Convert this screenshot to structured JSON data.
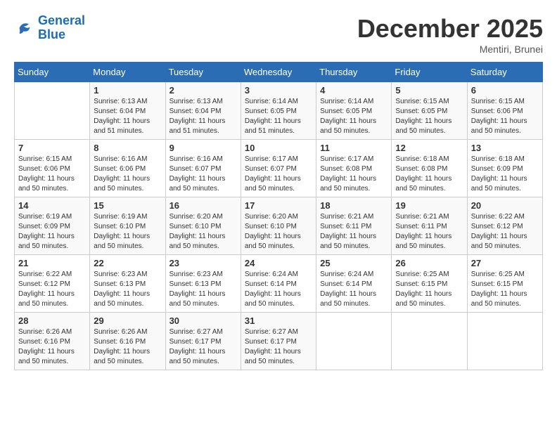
{
  "logo": {
    "line1": "General",
    "line2": "Blue"
  },
  "title": "December 2025",
  "subtitle": "Mentiri, Brunei",
  "header_days": [
    "Sunday",
    "Monday",
    "Tuesday",
    "Wednesday",
    "Thursday",
    "Friday",
    "Saturday"
  ],
  "weeks": [
    [
      {
        "day": "",
        "info": ""
      },
      {
        "day": "1",
        "info": "Sunrise: 6:13 AM\nSunset: 6:04 PM\nDaylight: 11 hours\nand 51 minutes."
      },
      {
        "day": "2",
        "info": "Sunrise: 6:13 AM\nSunset: 6:04 PM\nDaylight: 11 hours\nand 51 minutes."
      },
      {
        "day": "3",
        "info": "Sunrise: 6:14 AM\nSunset: 6:05 PM\nDaylight: 11 hours\nand 51 minutes."
      },
      {
        "day": "4",
        "info": "Sunrise: 6:14 AM\nSunset: 6:05 PM\nDaylight: 11 hours\nand 50 minutes."
      },
      {
        "day": "5",
        "info": "Sunrise: 6:15 AM\nSunset: 6:05 PM\nDaylight: 11 hours\nand 50 minutes."
      },
      {
        "day": "6",
        "info": "Sunrise: 6:15 AM\nSunset: 6:06 PM\nDaylight: 11 hours\nand 50 minutes."
      }
    ],
    [
      {
        "day": "7",
        "info": "Sunrise: 6:15 AM\nSunset: 6:06 PM\nDaylight: 11 hours\nand 50 minutes."
      },
      {
        "day": "8",
        "info": "Sunrise: 6:16 AM\nSunset: 6:06 PM\nDaylight: 11 hours\nand 50 minutes."
      },
      {
        "day": "9",
        "info": "Sunrise: 6:16 AM\nSunset: 6:07 PM\nDaylight: 11 hours\nand 50 minutes."
      },
      {
        "day": "10",
        "info": "Sunrise: 6:17 AM\nSunset: 6:07 PM\nDaylight: 11 hours\nand 50 minutes."
      },
      {
        "day": "11",
        "info": "Sunrise: 6:17 AM\nSunset: 6:08 PM\nDaylight: 11 hours\nand 50 minutes."
      },
      {
        "day": "12",
        "info": "Sunrise: 6:18 AM\nSunset: 6:08 PM\nDaylight: 11 hours\nand 50 minutes."
      },
      {
        "day": "13",
        "info": "Sunrise: 6:18 AM\nSunset: 6:09 PM\nDaylight: 11 hours\nand 50 minutes."
      }
    ],
    [
      {
        "day": "14",
        "info": "Sunrise: 6:19 AM\nSunset: 6:09 PM\nDaylight: 11 hours\nand 50 minutes."
      },
      {
        "day": "15",
        "info": "Sunrise: 6:19 AM\nSunset: 6:10 PM\nDaylight: 11 hours\nand 50 minutes."
      },
      {
        "day": "16",
        "info": "Sunrise: 6:20 AM\nSunset: 6:10 PM\nDaylight: 11 hours\nand 50 minutes."
      },
      {
        "day": "17",
        "info": "Sunrise: 6:20 AM\nSunset: 6:10 PM\nDaylight: 11 hours\nand 50 minutes."
      },
      {
        "day": "18",
        "info": "Sunrise: 6:21 AM\nSunset: 6:11 PM\nDaylight: 11 hours\nand 50 minutes."
      },
      {
        "day": "19",
        "info": "Sunrise: 6:21 AM\nSunset: 6:11 PM\nDaylight: 11 hours\nand 50 minutes."
      },
      {
        "day": "20",
        "info": "Sunrise: 6:22 AM\nSunset: 6:12 PM\nDaylight: 11 hours\nand 50 minutes."
      }
    ],
    [
      {
        "day": "21",
        "info": "Sunrise: 6:22 AM\nSunset: 6:12 PM\nDaylight: 11 hours\nand 50 minutes."
      },
      {
        "day": "22",
        "info": "Sunrise: 6:23 AM\nSunset: 6:13 PM\nDaylight: 11 hours\nand 50 minutes."
      },
      {
        "day": "23",
        "info": "Sunrise: 6:23 AM\nSunset: 6:13 PM\nDaylight: 11 hours\nand 50 minutes."
      },
      {
        "day": "24",
        "info": "Sunrise: 6:24 AM\nSunset: 6:14 PM\nDaylight: 11 hours\nand 50 minutes."
      },
      {
        "day": "25",
        "info": "Sunrise: 6:24 AM\nSunset: 6:14 PM\nDaylight: 11 hours\nand 50 minutes."
      },
      {
        "day": "26",
        "info": "Sunrise: 6:25 AM\nSunset: 6:15 PM\nDaylight: 11 hours\nand 50 minutes."
      },
      {
        "day": "27",
        "info": "Sunrise: 6:25 AM\nSunset: 6:15 PM\nDaylight: 11 hours\nand 50 minutes."
      }
    ],
    [
      {
        "day": "28",
        "info": "Sunrise: 6:26 AM\nSunset: 6:16 PM\nDaylight: 11 hours\nand 50 minutes."
      },
      {
        "day": "29",
        "info": "Sunrise: 6:26 AM\nSunset: 6:16 PM\nDaylight: 11 hours\nand 50 minutes."
      },
      {
        "day": "30",
        "info": "Sunrise: 6:27 AM\nSunset: 6:17 PM\nDaylight: 11 hours\nand 50 minutes."
      },
      {
        "day": "31",
        "info": "Sunrise: 6:27 AM\nSunset: 6:17 PM\nDaylight: 11 hours\nand 50 minutes."
      },
      {
        "day": "",
        "info": ""
      },
      {
        "day": "",
        "info": ""
      },
      {
        "day": "",
        "info": ""
      }
    ]
  ]
}
